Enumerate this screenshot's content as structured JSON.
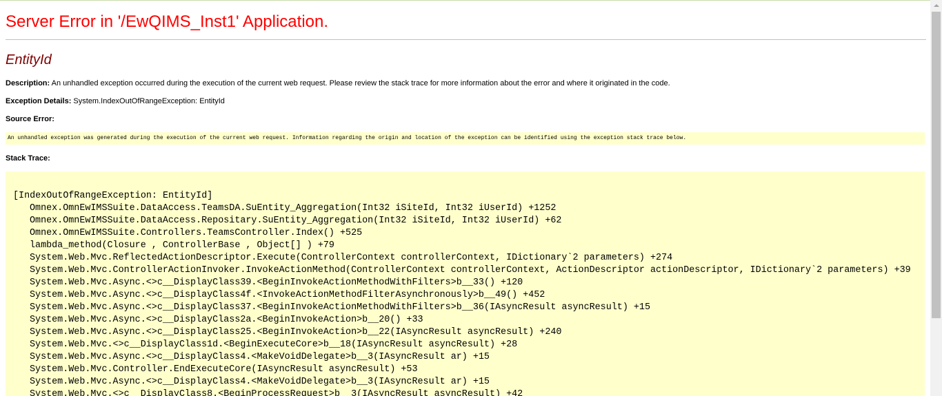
{
  "page": {
    "title": "Server Error in '/EwQIMS_Inst1' Application.",
    "subtitle": "EntityId",
    "description_label": "Description:",
    "description_text": "An unhandled exception occurred during the execution of the current web request. Please review the stack trace for more information about the error and where it originated in the code.",
    "exception_label": "Exception Details:",
    "exception_text": "System.IndexOutOfRangeException: EntityId",
    "source_label": "Source Error:",
    "source_text": "An unhandled exception was generated during the execution of the current web request. Information regarding the origin and location of the exception can be identified using the exception stack trace below.",
    "stack_label": "Stack Trace:",
    "stack_header": "[IndexOutOfRangeException: EntityId]",
    "stack_frames": [
      "Omnex.OmnEwIMSSuite.DataAccess.TeamsDA.SuEntity_Aggregation(Int32 iSiteId, Int32 iUserId) +1252",
      "Omnex.OmnEwIMSSuite.DataAccess.Repositary.SuEntity_Aggregation(Int32 iSiteId, Int32 iUserId) +62",
      "Omnex.OmnEwIMSSuite.Controllers.TeamsController.Index() +525",
      "lambda_method(Closure , ControllerBase , Object[] ) +79",
      "System.Web.Mvc.ReflectedActionDescriptor.Execute(ControllerContext controllerContext, IDictionary`2 parameters) +274",
      "System.Web.Mvc.ControllerActionInvoker.InvokeActionMethod(ControllerContext controllerContext, ActionDescriptor actionDescriptor, IDictionary`2 parameters) +39",
      "System.Web.Mvc.Async.<>c__DisplayClass39.<BeginInvokeActionMethodWithFilters>b__33() +120",
      "System.Web.Mvc.Async.<>c__DisplayClass4f.<InvokeActionMethodFilterAsynchronously>b__49() +452",
      "System.Web.Mvc.Async.<>c__DisplayClass37.<BeginInvokeActionMethodWithFilters>b__36(IAsyncResult asyncResult) +15",
      "System.Web.Mvc.Async.<>c__DisplayClass2a.<BeginInvokeAction>b__20() +33",
      "System.Web.Mvc.Async.<>c__DisplayClass25.<BeginInvokeAction>b__22(IAsyncResult asyncResult) +240",
      "System.Web.Mvc.<>c__DisplayClass1d.<BeginExecuteCore>b__18(IAsyncResult asyncResult) +28",
      "System.Web.Mvc.Async.<>c__DisplayClass4.<MakeVoidDelegate>b__3(IAsyncResult ar) +15",
      "System.Web.Mvc.Controller.EndExecuteCore(IAsyncResult asyncResult) +53",
      "System.Web.Mvc.Async.<>c__DisplayClass4.<MakeVoidDelegate>b__3(IAsyncResult ar) +15",
      "System.Web.Mvc.<>c__DisplayClass8.<BeginProcessRequest>b__3(IAsyncResult asyncResult) +42"
    ]
  },
  "colors": {
    "title": "#ff0000",
    "subtitle": "#800000",
    "code_background": "#ffffcc"
  }
}
